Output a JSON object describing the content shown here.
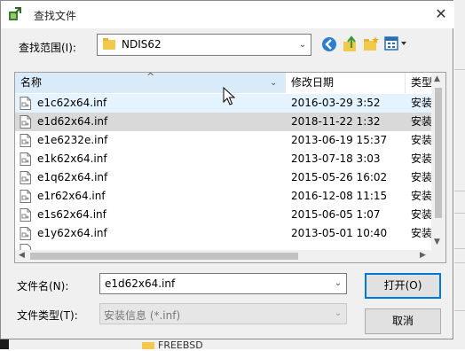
{
  "dialog": {
    "title": "查找文件",
    "close_glyph": "✕"
  },
  "look_in": {
    "label": "查找范围(I):",
    "value": "NDIS62"
  },
  "toolbar": {
    "back_icon": "back-arrow-icon",
    "up_icon": "up-folder-icon",
    "new_folder_icon": "new-folder-icon",
    "view_menu_icon": "view-menu-icon"
  },
  "list": {
    "columns": [
      "名称",
      "修改日期",
      "类型"
    ],
    "sort_glyph": "^",
    "rows": [
      {
        "name": "e1c62x64.inf",
        "date": "2016-03-29 3:52",
        "type": "安装"
      },
      {
        "name": "e1d62x64.inf",
        "date": "2018-11-22 1:32",
        "type": "安装"
      },
      {
        "name": "e1e6232e.inf",
        "date": "2013-06-19 15:37",
        "type": "安装"
      },
      {
        "name": "e1k62x64.inf",
        "date": "2013-07-18 3:03",
        "type": "安装"
      },
      {
        "name": "e1q62x64.inf",
        "date": "2015-05-26 16:02",
        "type": "安装"
      },
      {
        "name": "e1r62x64.inf",
        "date": "2016-12-08 11:15",
        "type": "安装"
      },
      {
        "name": "e1s62x64.inf",
        "date": "2015-06-05 1:07",
        "type": "安装"
      },
      {
        "name": "e1y62x64.inf",
        "date": "2013-05-01 10:40",
        "type": "安装"
      }
    ],
    "hover_row": 0,
    "selected_row": 1
  },
  "filename": {
    "label": "文件名(N):",
    "value": "e1d62x64.inf"
  },
  "filetype": {
    "label": "文件类型(T):",
    "value": "安装信息 (*.inf)"
  },
  "buttons": {
    "open": "打开(O)",
    "cancel": "取消"
  },
  "background": {
    "folder_text": "FREEBSD"
  },
  "colors": {
    "hover": "#e5f3ff",
    "selected": "#d9d9d9",
    "accent": "#0078d7",
    "folder": "#f1c94c"
  }
}
